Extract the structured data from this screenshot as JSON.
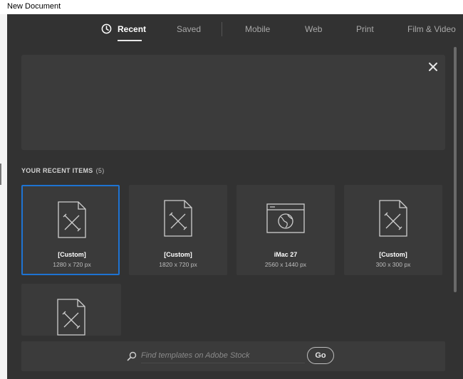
{
  "window": {
    "title": "New Document"
  },
  "tabs": [
    {
      "label": "Recent",
      "active": true,
      "icon": "clock-icon"
    },
    {
      "label": "Saved",
      "active": false
    },
    {
      "label": "Mobile",
      "active": false
    },
    {
      "label": "Web",
      "active": false
    },
    {
      "label": "Print",
      "active": false
    },
    {
      "label": "Film & Video",
      "active": false
    }
  ],
  "banner": {
    "close_icon": "close-icon"
  },
  "recent": {
    "heading": "YOUR RECENT ITEMS",
    "count": "(5)",
    "items": [
      {
        "name": "[Custom]",
        "dims": "1280 x 720 px",
        "icon": "document-pencil-icon",
        "selected": true
      },
      {
        "name": "[Custom]",
        "dims": "1820 x 720 px",
        "icon": "document-pencil-icon",
        "selected": false
      },
      {
        "name": "iMac 27",
        "dims": "2560 x 1440 px",
        "icon": "browser-globe-icon",
        "selected": false
      },
      {
        "name": "[Custom]",
        "dims": "300 x 300 px",
        "icon": "document-pencil-icon",
        "selected": false
      },
      {
        "name": "",
        "dims": "",
        "icon": "document-pencil-icon",
        "selected": false
      }
    ]
  },
  "search": {
    "placeholder": "Find templates on Adobe Stock",
    "value": "",
    "go_label": "Go",
    "icon": "search-icon"
  },
  "colors": {
    "background": "#323232",
    "card": "#3a3a3a",
    "selected_border": "#1e73d2",
    "text_active": "#ffffff",
    "text_muted": "#a8a8a8"
  }
}
